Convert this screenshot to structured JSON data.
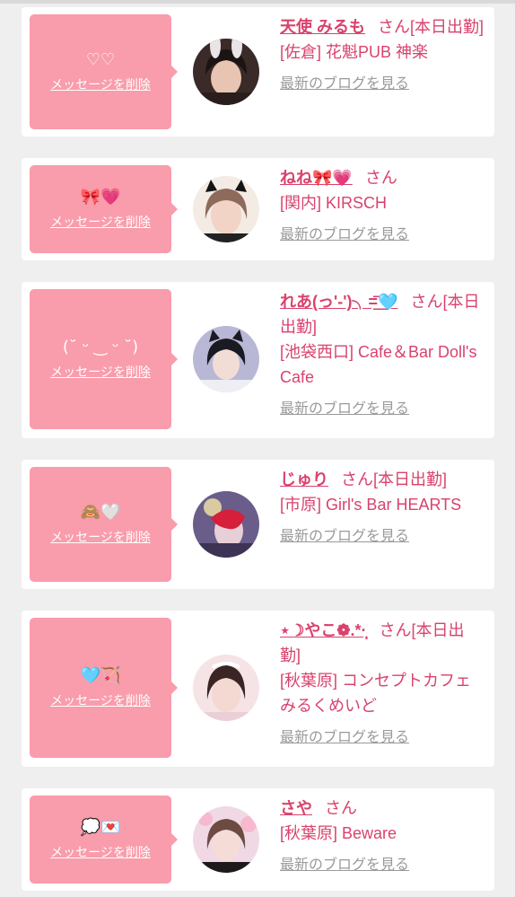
{
  "entries": [
    {
      "message": "♡♡",
      "delete_label": "メッセージを削除",
      "name": "天使 みるも",
      "suffix": "さん[本日出勤]",
      "shop": "[佐倉] 花魁PUB 神楽",
      "blog_label": "最新のブログを見る"
    },
    {
      "message": "🎀💗",
      "delete_label": "メッセージを削除",
      "name": "ねね🎀💗",
      "suffix": "さん",
      "shop": "[関内] KIRSCH",
      "blog_label": "最新のブログを見る"
    },
    {
      "message": "(˘ ᵕ ‿ ᵕ ˘)",
      "delete_label": "メッセージを削除",
      "name": "れあ(っ'-')╮=͟͟͞͞🩵",
      "suffix": "さん[本日出勤]",
      "shop": "[池袋西口] Cafe＆Bar Doll's Cafe",
      "blog_label": "最新のブログを見る"
    },
    {
      "message": "🙈🤍",
      "delete_label": "メッセージを削除",
      "name": "じゅり",
      "suffix": "さん[本日出勤]",
      "shop": "[市原] Girl's Bar HEARTS",
      "blog_label": "最新のブログを見る"
    },
    {
      "message": "🩵🏹",
      "delete_label": "メッセージを削除",
      "name": "⋆☽やこ❁.*·̩͙",
      "suffix": "さん[本日出勤]",
      "shop": "[秋葉原] コンセプトカフェ みるくめいど",
      "blog_label": "最新のブログを見る"
    },
    {
      "message": "💭💌",
      "delete_label": "メッセージを削除",
      "name": "さや",
      "suffix": "さん",
      "shop": "[秋葉原] Beware",
      "blog_label": "最新のブログを見る"
    }
  ],
  "colors": {
    "bubble": "#f99cab",
    "accent": "#d9426d",
    "muted": "#9a9a9a",
    "background": "#efefef"
  }
}
